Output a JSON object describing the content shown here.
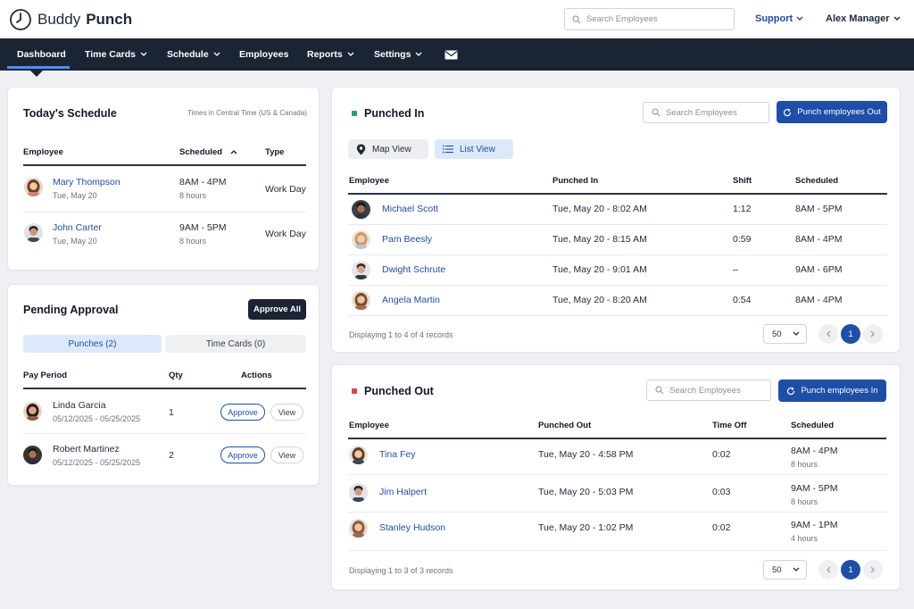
{
  "header": {
    "logo_text_1": "Buddy",
    "logo_text_2": "Punch",
    "search_placeholder": "Search Employees",
    "support_label": "Support",
    "user_name": "Alex Manager"
  },
  "nav": {
    "items": [
      {
        "label": "Dashboard",
        "dropdown": false
      },
      {
        "label": "Time Cards",
        "dropdown": true
      },
      {
        "label": "Schedule",
        "dropdown": true
      },
      {
        "label": "Employees",
        "dropdown": false
      },
      {
        "label": "Reports",
        "dropdown": true
      },
      {
        "label": "Settings",
        "dropdown": true
      }
    ],
    "mail_icon": "envelope-icon"
  },
  "todays_schedule": {
    "title": "Today's Schedule",
    "timezone_note": "Times in Central Time (US & Canada)",
    "columns": [
      "Employee",
      "Scheduled",
      "Type"
    ],
    "rows": [
      {
        "name": "Mary Thompson",
        "date": "Tue, May 20",
        "shift": "8AM - 4PM",
        "hours": "8 hours",
        "type": "Work Day"
      },
      {
        "name": "John Carter",
        "date": "Tue, May 20",
        "shift": "9AM - 5PM",
        "hours": "8 hours",
        "type": "Work Day"
      }
    ]
  },
  "pending_approval": {
    "title": "Pending Approval",
    "approve_all_label": "Approve All",
    "tabs": [
      {
        "label": "Punches (2)",
        "active": true
      },
      {
        "label": "Time Cards (0)",
        "active": false
      }
    ],
    "columns": [
      "Pay Period",
      "Qty",
      "Actions"
    ],
    "rows": [
      {
        "name": "Linda Garcia",
        "period": "05/12/2025 - 05/25/2025",
        "qty": "1",
        "approve_label": "Approve",
        "view_label": "View"
      },
      {
        "name": "Robert Martinez",
        "period": "05/12/2025 - 05/25/2025",
        "qty": "2",
        "approve_label": "Approve",
        "view_label": "View"
      }
    ]
  },
  "punched_in": {
    "title": "Punched In",
    "search_placeholder": "Search Employees",
    "action_label": "Punch employees Out",
    "view_tabs": [
      {
        "label": "Map View",
        "active": false
      },
      {
        "label": "List View",
        "active": true
      }
    ],
    "columns": [
      "Employee",
      "Punched In",
      "Shift",
      "Scheduled"
    ],
    "rows": [
      {
        "name": "Michael Scott",
        "punched": "Tue, May 20 - 8:02 AM",
        "shift": "1:12",
        "scheduled": "8AM - 5PM"
      },
      {
        "name": "Pam Beesly",
        "punched": "Tue, May 20 - 8:15 AM",
        "shift": "0:59",
        "scheduled": "8AM - 4PM"
      },
      {
        "name": "Dwight Schrute",
        "punched": "Tue, May 20 - 9:01 AM",
        "shift": "–",
        "scheduled": "9AM - 6PM"
      },
      {
        "name": "Angela Martin",
        "punched": "Tue, May 20 - 8:20 AM",
        "shift": "0:54",
        "scheduled": "8AM - 4PM"
      }
    ],
    "footer_text": "Displaying 1 to 4 of 4 records",
    "page_size": "50",
    "current_page": "1",
    "status_color": "#22a06b"
  },
  "punched_out": {
    "title": "Punched Out",
    "search_placeholder": "Search Employees",
    "action_label": "Punch employees In",
    "columns": [
      "Employee",
      "Punched Out",
      "Time Off",
      "Scheduled"
    ],
    "rows": [
      {
        "name": "Tina Fey",
        "punched": "Tue, May 20 - 4:58 PM",
        "time_off": "0:02",
        "scheduled": "8AM - 4PM",
        "hours": "8 hours"
      },
      {
        "name": "Jim Halpert",
        "punched": "Tue, May 20 - 5:03 PM",
        "time_off": "0:03",
        "scheduled": "9AM - 5PM",
        "hours": "8 hours"
      },
      {
        "name": "Stanley Hudson",
        "punched": "Tue, May 20 - 1:02 PM",
        "time_off": "0:02",
        "scheduled": "9AM - 1PM",
        "hours": "4 hours"
      }
    ],
    "footer_text": "Displaying 1 to 3 of 3 records",
    "page_size": "50",
    "current_page": "1",
    "status_color": "#e23d4b"
  },
  "colors": {
    "brand_dark": "#1b2433",
    "accent_blue": "#1e4ea8",
    "link_blue": "#1e4ea8",
    "active_tab_bg": "#dde9fb"
  }
}
